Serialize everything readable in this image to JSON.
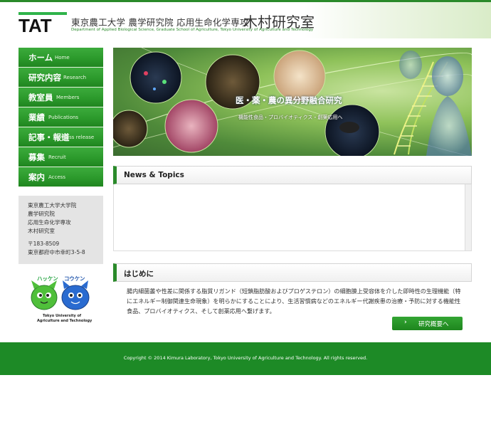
{
  "header": {
    "logo_text": "TAT",
    "title_jp": "東京農工大学 農学研究院 応用生命化学専攻",
    "lab_name": "木村研究室",
    "subtitle_en": "Department of Applied Biological Science, Graduate School of Agriculture, Tokyo University of Agriculture and Technology"
  },
  "nav": {
    "items": [
      {
        "jp": "ホーム",
        "en": "Home"
      },
      {
        "jp": "研究内容",
        "en": "Research"
      },
      {
        "jp": "教室員",
        "en": "Members"
      },
      {
        "jp": "業績",
        "en": "Publications"
      },
      {
        "jp": "記事・報道",
        "en": "Press release"
      },
      {
        "jp": "募集",
        "en": "Recruit"
      },
      {
        "jp": "案内",
        "en": "Access"
      }
    ]
  },
  "address": {
    "lines": [
      "東京農工大学大学院",
      "農学研究院",
      "応用生命化学専攻",
      "木村研究室"
    ],
    "postal": "〒183-8509",
    "street": "東京都府中市幸町3-5-8"
  },
  "mascot": {
    "left_name": "ハッケン",
    "right_name": "コウケン",
    "caption_line1": "Tokyo University of",
    "caption_line2": "Agriculture and Technology"
  },
  "hero": {
    "title": "医・薬・農の異分野融合研究",
    "subtitle": "機能性食品・プロバイオティクス・創薬応用へ"
  },
  "news": {
    "heading": "News & Topics"
  },
  "intro": {
    "heading": "はじめに",
    "body": "腸内細菌叢や性差に関係する脂質リガンド（短鎖脂肪酸およびプロゲステロン）の細胞膜上受容体を介した即時性の生理機能（特にエネルギー制御関連生命現象）を明らかにすることにより、生活習慣病などのエネルギー代謝疾患の治療・予防に対する機能性食品、プロバイオティクス、そして創薬応用へ繋げます。",
    "button_label": "研究概要へ",
    "button_arrow": "›"
  },
  "footer": {
    "copyright": "Copyright © 2014 Kimura Laboratory, Tokyo University of Agriculture and Technology. All rights reserved."
  },
  "colors": {
    "brand_green": "#2a8a2a",
    "footer_green": "#1d8a26",
    "address_bg": "#e4e4e4"
  }
}
